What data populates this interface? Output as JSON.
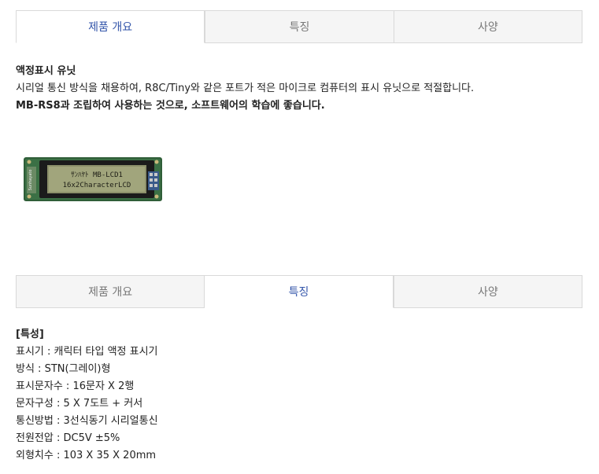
{
  "tabs_top": [
    {
      "label": "제품 개요",
      "active": true
    },
    {
      "label": "특징",
      "active": false
    },
    {
      "label": "사양",
      "active": false
    }
  ],
  "overview": {
    "title": "액정표시 유닛",
    "line1": "시리얼 통신 방식을 채용하여, R8C/Tiny와 같은 포트가 적은 마이크로 컴퓨터의 표시 유닛으로 적절합니다.",
    "line2": "MB-RS8과 조립하여 사용하는 것으로, 소프트웨어의 학습에 좋습니다."
  },
  "product_image": {
    "line1": "ｻﾝﾊﾔﾄ MB-LCD1",
    "line2": "16x2CharacterLCD",
    "side_text": "Sunhayato"
  },
  "tabs_bottom": [
    {
      "label": "제품 개요",
      "active": false
    },
    {
      "label": "특징",
      "active": true
    },
    {
      "label": "사양",
      "active": false
    }
  ],
  "features": {
    "title": "[특성]",
    "items": [
      "표시기 : 캐릭터 타입 액정 표시기",
      "방식 : STN(그레이)형",
      "표시문자수 : 16문자 X 2행",
      "문자구성 : 5 X 7도트 + 커서",
      "통신방법 : 3선식동기 시리얼통신",
      "전원전압 : DC5V ±5%",
      "외형치수 : 103 X 35 X 20mm"
    ]
  }
}
